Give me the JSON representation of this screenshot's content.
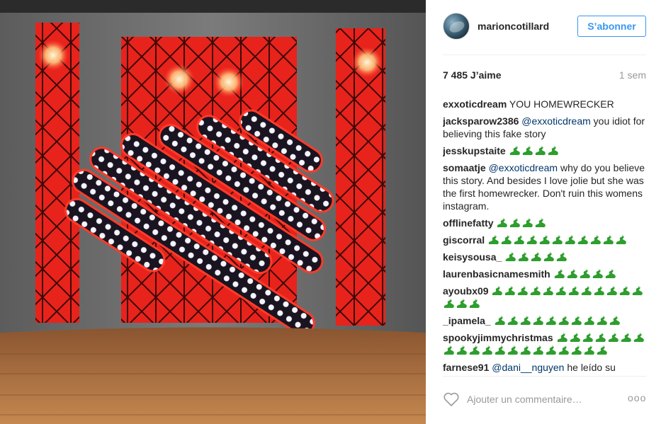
{
  "colors": {
    "accent": "#3897f0",
    "mention": "#003569",
    "muted": "#999999",
    "text": "#262626",
    "emoji": "#2e9e2e"
  },
  "photo": {
    "alt_icon": "photo-image"
  },
  "header": {
    "username": "marioncotillard",
    "follow_label": "S’abonner"
  },
  "stats": {
    "likes": "7 485 J’aime",
    "time": "1 sem"
  },
  "comments": [
    {
      "user": "exxoticdream",
      "mention": "",
      "text": "YOU HOMEWRECKER",
      "emoji_count": 0
    },
    {
      "user": "jacksparow2386",
      "mention": "@exxoticdream",
      "text": "you idiot for believing this fake story",
      "emoji_count": 0
    },
    {
      "user": "jesskupstaite",
      "mention": "",
      "text": "",
      "emoji_count": 4
    },
    {
      "user": "somaatje",
      "mention": "@exxoticdream",
      "text": "why do you believe this story. And besides I love jolie but she was the first homewrecker. Don't ruin this womens instagram.",
      "emoji_count": 0
    },
    {
      "user": "offlinefatty",
      "mention": "",
      "text": "",
      "emoji_count": 4
    },
    {
      "user": "giscorral",
      "mention": "",
      "text": "",
      "emoji_count": 11
    },
    {
      "user": "keisysousa_",
      "mention": "",
      "text": "",
      "emoji_count": 5
    },
    {
      "user": "laurenbasicnamesmith",
      "mention": "",
      "text": "",
      "emoji_count": 5
    },
    {
      "user": "ayoubx09",
      "mention": "",
      "text": "",
      "emoji_count": 15
    },
    {
      "user": "_ipamela_",
      "mention": "",
      "text": "",
      "emoji_count": 10
    },
    {
      "user": "spookyjimmychristmas",
      "mention": "",
      "text": "",
      "emoji_count": 20
    },
    {
      "user": "farnese91",
      "mention": "@dani__nguyen",
      "text": "he leído su",
      "emoji_count": 0
    }
  ],
  "add_comment": {
    "placeholder": "Ajouter un commentaire…",
    "more_label": "ooo"
  }
}
